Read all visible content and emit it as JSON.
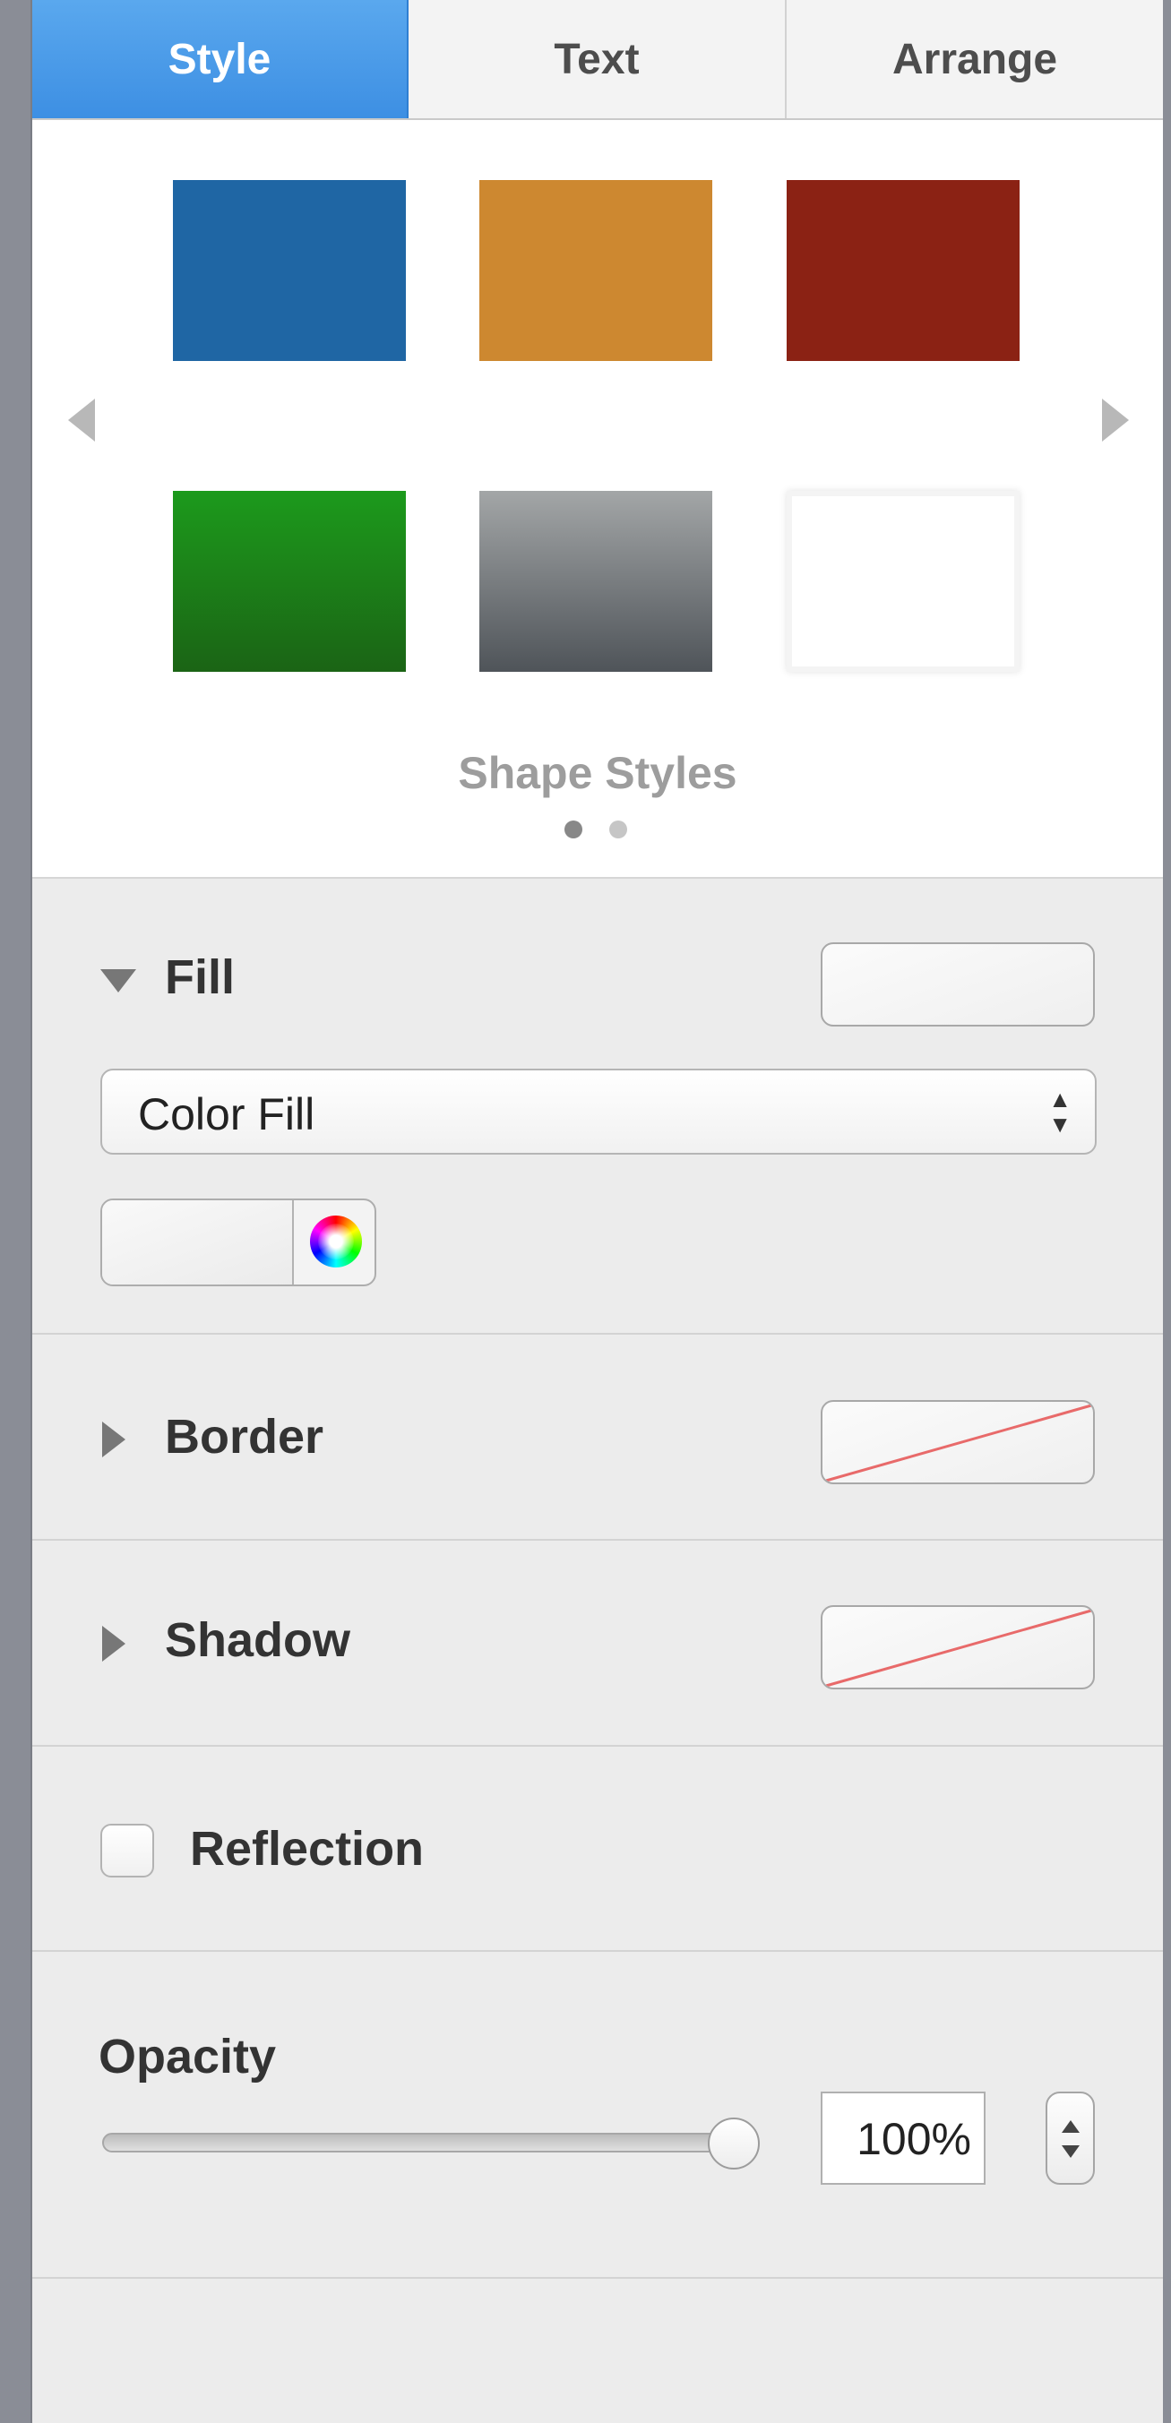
{
  "tabs": [
    {
      "label": "Style",
      "active": true
    },
    {
      "label": "Text",
      "active": false
    },
    {
      "label": "Arrange",
      "active": false
    }
  ],
  "shape_styles": {
    "caption": "Shape Styles",
    "page": 1,
    "page_count": 2,
    "swatch_colors": [
      "#1f66a4",
      "#cd8830",
      "#8b2214",
      "#1e871e",
      "#8c8f94",
      "#ffffff"
    ]
  },
  "fill": {
    "title": "Fill",
    "expanded": true,
    "type": "Color Fill",
    "color": "#f4f4f4"
  },
  "border": {
    "title": "Border",
    "expanded": false,
    "value": "none"
  },
  "shadow": {
    "title": "Shadow",
    "expanded": false,
    "value": "none"
  },
  "reflection": {
    "label": "Reflection",
    "checked": false
  },
  "opacity": {
    "label": "Opacity",
    "value": "100%",
    "level": 1.0
  },
  "icons": {
    "left_arrow": "chevron-left-icon",
    "right_arrow": "chevron-right-icon",
    "color_wheel": "color-wheel-icon"
  },
  "colors": {
    "accent": "#3d8fe3",
    "none_slash": "#e86a6a",
    "strip": "#8a8d96"
  }
}
